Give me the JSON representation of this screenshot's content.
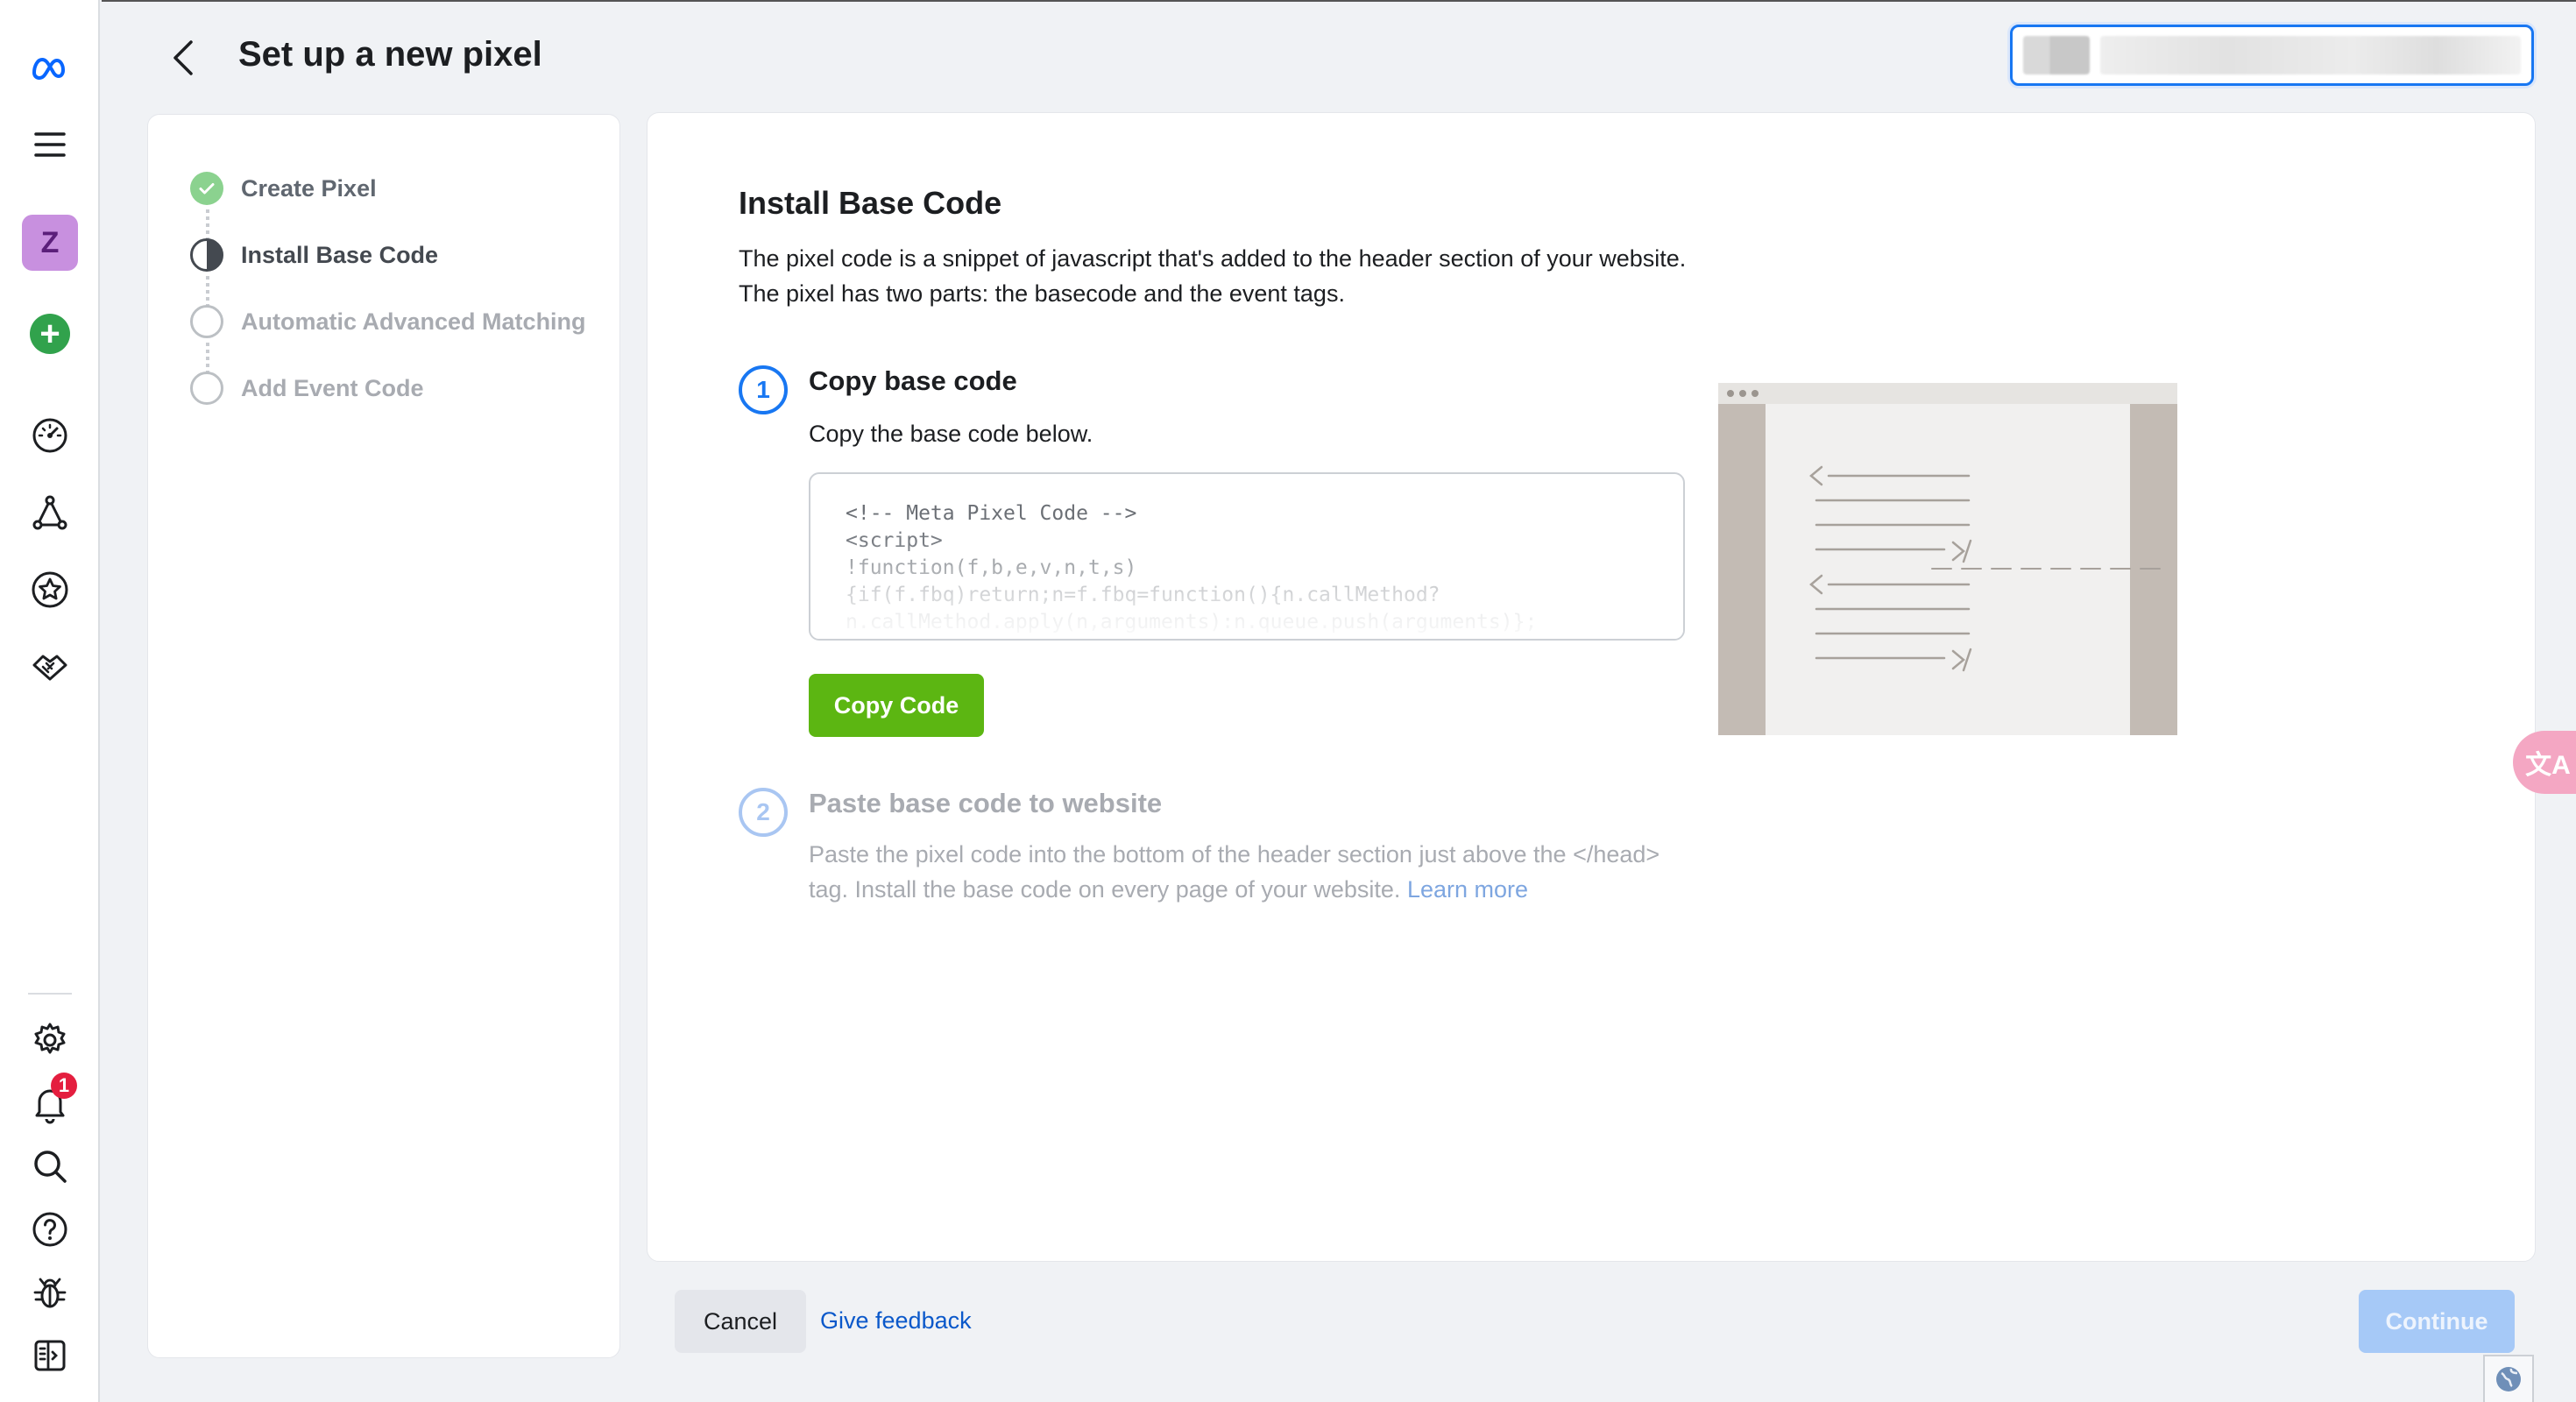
{
  "header": {
    "title": "Set up a new pixel"
  },
  "rail": {
    "account_initial": "Z",
    "notification_count": "1"
  },
  "stepper": {
    "steps": [
      {
        "label": "Create Pixel",
        "state": "done"
      },
      {
        "label": "Install Base Code",
        "state": "active"
      },
      {
        "label": "Automatic Advanced Matching",
        "state": "todo"
      },
      {
        "label": "Add Event Code",
        "state": "todo"
      }
    ]
  },
  "main": {
    "title": "Install Base Code",
    "description_line1": "The pixel code is a snippet of javascript that's added to the header section of your website.",
    "description_line2": "The pixel has two parts: the basecode and the event tags.",
    "step1": {
      "number": "1",
      "title": "Copy base code",
      "description": "Copy the base code below.",
      "code_lines": [
        "<!-- Meta Pixel Code -->",
        "<script>",
        "!function(f,b,e,v,n,t,s)",
        "{if(f.fbq)return;n=f.fbq=function(){n.callMethod?",
        "n.callMethod.apply(n,arguments):n.queue.push(arguments)};"
      ],
      "copy_label": "Copy Code"
    },
    "step2": {
      "number": "2",
      "title": "Paste base code to website",
      "description": "Paste the pixel code into the bottom of the header section just above the </head> tag. Install the base code on every page of your website.",
      "learn_more": "Learn more"
    }
  },
  "footer": {
    "cancel_label": "Cancel",
    "feedback_label": "Give feedback",
    "continue_label": "Continue"
  },
  "widgets": {
    "translate_label": "文A"
  },
  "colors": {
    "primary_blue": "#1877f2",
    "copy_green": "#5cb612",
    "continue_disabled": "#a6c9f7",
    "step_done_green": "#8bd28f",
    "notification_red": "#e41e3f",
    "account_purple": "#c890df"
  }
}
